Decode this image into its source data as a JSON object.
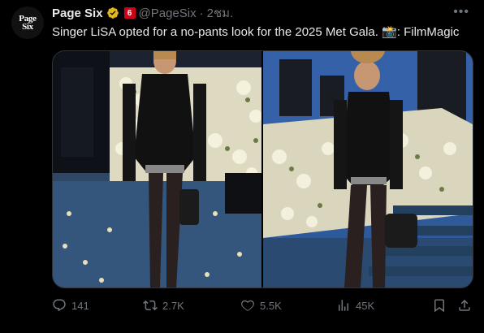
{
  "account": {
    "avatar_line1": "Page",
    "avatar_line2": "Six",
    "name": "Page Six",
    "affiliate_badge": "6",
    "handle": "@PageSix",
    "separator": "·",
    "time": "2ชม."
  },
  "tweet": {
    "text": "Singer LiSA opted for a no-pants look for the 2025 Met Gala. 📸: FilmMagic"
  },
  "media": {
    "photos": [
      {
        "label": "left-photo"
      },
      {
        "label": "right-photo"
      }
    ]
  },
  "actions": {
    "replies": "141",
    "reposts": "2.7K",
    "likes": "5.5K",
    "views": "45K"
  },
  "icons": {
    "reply": "reply-icon",
    "repost": "repost-icon",
    "like": "heart-icon",
    "views": "views-icon",
    "bookmark": "bookmark-icon",
    "share": "share-icon",
    "more": "more-icon",
    "verified": "verified-badge-icon"
  },
  "colors": {
    "background": "#000000",
    "text": "#e7e9ea",
    "muted": "#71767b",
    "verified": "#e2b719",
    "badge": "#d0021b"
  }
}
